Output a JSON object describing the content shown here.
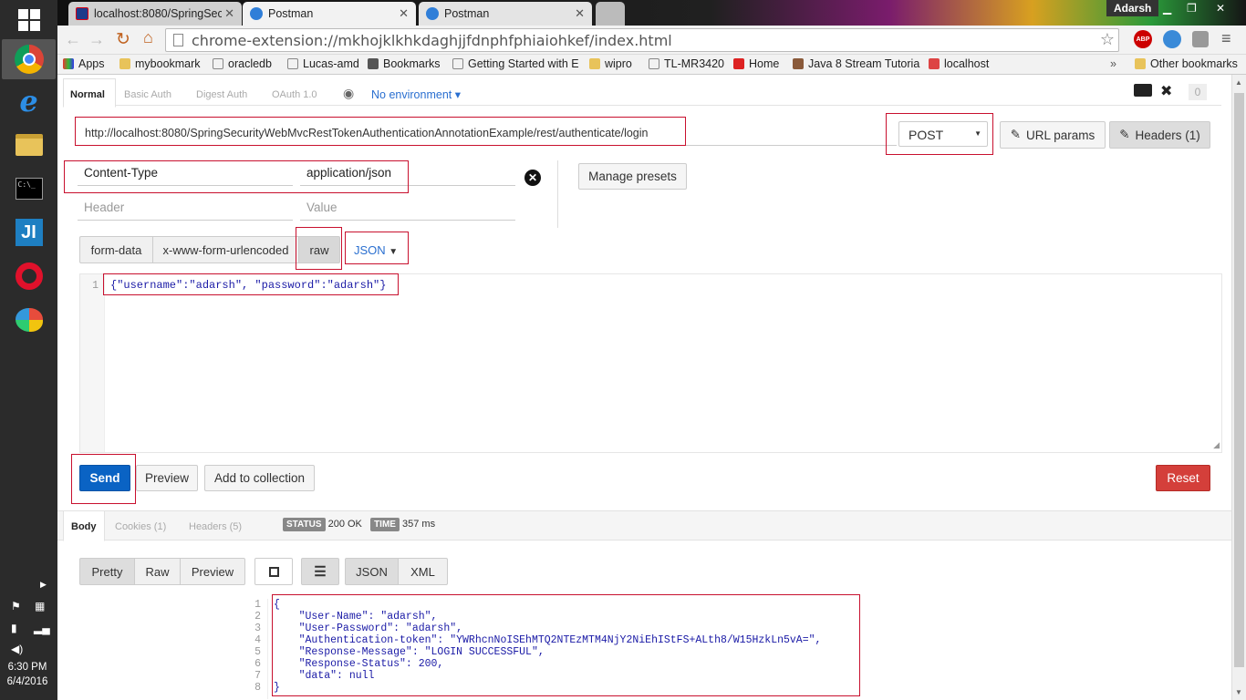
{
  "os": {
    "clock_time": "6:30 PM",
    "clock_date": "6/4/2016"
  },
  "browser": {
    "tabs": [
      {
        "label": "localhost:8080/SpringSecu"
      },
      {
        "label": "Postman"
      },
      {
        "label": "Postman"
      }
    ],
    "user": "Adarsh",
    "address": "chrome-extension://mkhojklkhkdaghjjfdnphfphiaiohkef/index.html",
    "abp_label": "ABP",
    "bookmarks": [
      "Apps",
      "mybookmark",
      "oracledb",
      "Lucas-amd",
      "Bookmarks",
      "Getting Started with E",
      "wipro",
      "TL-MR3420",
      "Home",
      "Java 8 Stream Tutoria",
      "localhost",
      "Other bookmarks"
    ],
    "bookmarks_more": "»"
  },
  "postman": {
    "auth_tabs": [
      "Normal",
      "Basic Auth",
      "Digest Auth",
      "OAuth 1.0"
    ],
    "environment": "No environment",
    "counter": "0",
    "request_url": "http://localhost:8080/SpringSecurityWebMvcRestTokenAuthenticationAnnotationExample/rest/authenticate/login",
    "method": "POST",
    "url_params_label": "URL params",
    "headers_label": "Headers (1)",
    "header_key": "Content-Type",
    "header_value": "application/json",
    "header_key_placeholder": "Header",
    "header_value_placeholder": "Value",
    "manage_presets": "Manage presets",
    "body_modes": [
      "form-data",
      "x-www-form-urlencoded",
      "raw"
    ],
    "body_format": "JSON",
    "body_line_no": "1",
    "body_text": "{\"username\":\"adarsh\", \"password\":\"adarsh\"}",
    "send_label": "Send",
    "preview_label": "Preview",
    "add_collection_label": "Add to collection",
    "reset_label": "Reset",
    "response_tabs": [
      "Body",
      "Cookies (1)",
      "Headers (5)"
    ],
    "status_tag": "STATUS",
    "status_value": "200 OK",
    "time_tag": "TIME",
    "time_value": "357 ms",
    "view_modes": [
      "Pretty",
      "Raw",
      "Preview"
    ],
    "formats": [
      "JSON",
      "XML"
    ],
    "response_lines": [
      "{",
      "    \"User-Name\": \"adarsh\",",
      "    \"User-Password\": \"adarsh\",",
      "    \"Authentication-token\": \"YWRhcnNoISEhMTQ2NTEzMTM4NjY2NiEhIStFS+ALth8/W15HzkLn5vA=\",",
      "    \"Response-Message\": \"LOGIN SUCCESSFUL\",",
      "    \"Response-Status\": 200,",
      "    \"data\": null",
      "}"
    ],
    "response_line_numbers": [
      "1",
      "2",
      "3",
      "4",
      "5",
      "6",
      "7",
      "8"
    ]
  },
  "colors": {
    "send": "#0a63c4",
    "reset": "#d43f3a",
    "highlight": "#c8102e",
    "link": "#2a6fd0"
  }
}
